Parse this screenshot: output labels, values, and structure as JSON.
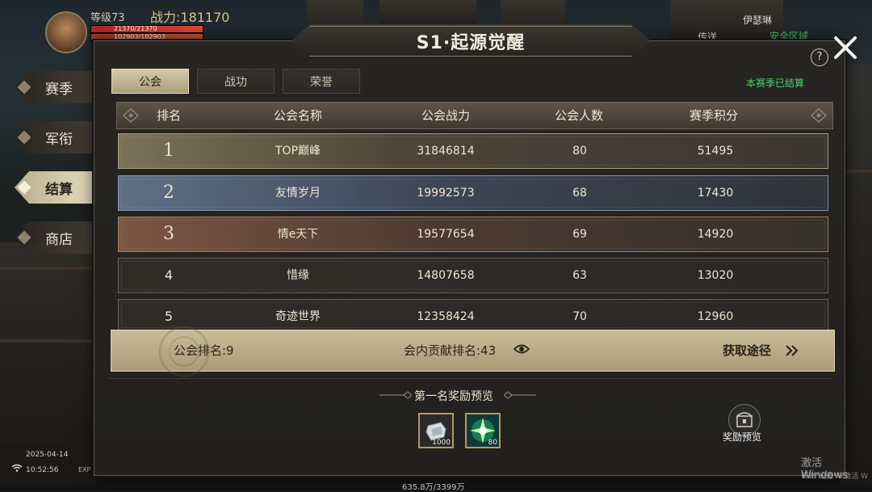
{
  "hud": {
    "level": "等级73",
    "power": "战力:181170",
    "hp": "21370/21370",
    "mp": "102903/102903",
    "player_name": "伊瑟琳",
    "teleport": "传送",
    "safe_zone": "安全区域",
    "date": "2025-04-14",
    "time": "10:52:56",
    "exp_label": "EXP",
    "exp_value": "635.8万/3399万",
    "hp_fill": 1,
    "mp_fill": 1
  },
  "watermark": {
    "line1": "激活 Windows",
    "line2": "转到\"设置\"以激活 W"
  },
  "side_tabs": [
    "赛季",
    "军衔",
    "结算",
    "商店"
  ],
  "side_active": "结算",
  "title": "S1·起源觉醒",
  "help": "?",
  "tabs": [
    "公会",
    "战功",
    "荣誉"
  ],
  "active_tab": "公会",
  "season_status": "本赛季已结算",
  "table": {
    "headers": [
      "排名",
      "公会名称",
      "公会战力",
      "公会人数",
      "赛季积分"
    ],
    "rows": [
      {
        "rank": "1",
        "name": "TOP巅峰",
        "power": "31846814",
        "members": "80",
        "score": "51495"
      },
      {
        "rank": "2",
        "name": "友情岁月",
        "power": "19992573",
        "members": "68",
        "score": "17430"
      },
      {
        "rank": "3",
        "name": "情e天下",
        "power": "19577654",
        "members": "69",
        "score": "14920"
      },
      {
        "rank": "4",
        "name": "惜缘",
        "power": "14807658",
        "members": "63",
        "score": "13020"
      },
      {
        "rank": "5",
        "name": "奇迹世界",
        "power": "12358424",
        "members": "70",
        "score": "12960"
      }
    ]
  },
  "my_guild": {
    "rank_text": "公会排名:9",
    "contribution_text": "会内贡献排名:43",
    "obtain_text": "获取途径"
  },
  "rewards": {
    "title": "第一名奖励预览",
    "items": [
      {
        "icon": "silver-ingot-icon",
        "count": "1000"
      },
      {
        "icon": "green-burst-icon",
        "count": "80"
      }
    ],
    "preview_label": "奖励预览"
  },
  "colors": {
    "accent_green": "#4fcf67",
    "gold_bar": "#c9bc98",
    "rank1": "#7a7358",
    "rank2": "#5f7089",
    "rank3": "#7c5543"
  }
}
